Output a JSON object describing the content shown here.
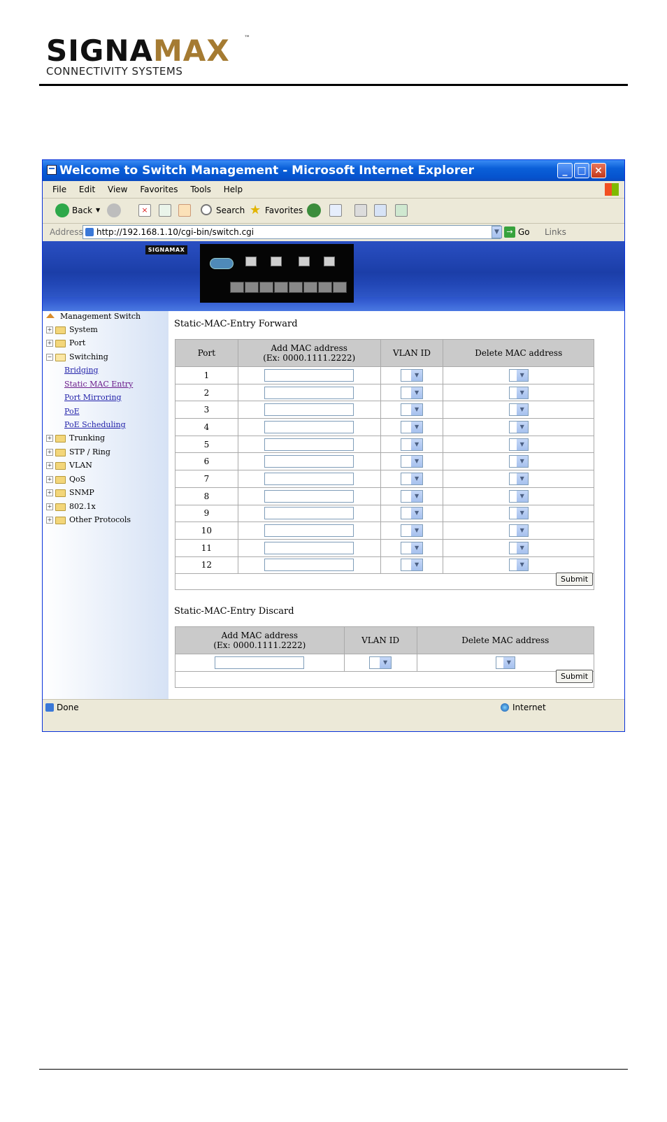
{
  "doc": {
    "logo": {
      "brand_part1": "SIGNA",
      "brand_part2": "MAX",
      "tagline": "CONNECTIVITY SYSTEMS",
      "tm": "™"
    }
  },
  "window": {
    "title": "Welcome to Switch Management - Microsoft Internet Explorer",
    "menu": [
      "File",
      "Edit",
      "View",
      "Favorites",
      "Tools",
      "Help"
    ],
    "toolbar": {
      "back_label": "Back",
      "search_label": "Search",
      "favorites_label": "Favorites"
    },
    "address": {
      "label": "Address",
      "url": "http://192.168.1.10/cgi-bin/switch.cgi",
      "go_label": "Go",
      "links_label": "Links"
    },
    "status": {
      "text": "Done",
      "zone": "Internet"
    }
  },
  "banner": {
    "logo_text": "SIGNAMAX"
  },
  "sidebar": {
    "root": "Management Switch",
    "items": [
      {
        "label": "System",
        "type": "folder"
      },
      {
        "label": "Port",
        "type": "folder"
      },
      {
        "label": "Switching",
        "type": "folder-open"
      },
      {
        "label": "Bridging",
        "type": "link"
      },
      {
        "label": "Static MAC Entry",
        "type": "link-visited"
      },
      {
        "label": "Port Mirroring",
        "type": "link"
      },
      {
        "label": "PoE",
        "type": "link"
      },
      {
        "label": "PoE Scheduling",
        "type": "link"
      },
      {
        "label": "Trunking",
        "type": "folder"
      },
      {
        "label": "STP / Ring",
        "type": "folder"
      },
      {
        "label": "VLAN",
        "type": "folder"
      },
      {
        "label": "QoS",
        "type": "folder"
      },
      {
        "label": "SNMP",
        "type": "folder"
      },
      {
        "label": "802.1x",
        "type": "folder"
      },
      {
        "label": "Other Protocols",
        "type": "folder"
      }
    ]
  },
  "forward": {
    "title": "Static-MAC-Entry Forward",
    "headers": {
      "port": "Port",
      "add_mac_line1": "Add MAC address",
      "add_mac_line2": "(Ex: 0000.1111.2222)",
      "vlan": "VLAN ID",
      "delete_mac": "Delete MAC address"
    },
    "ports": [
      "1",
      "2",
      "3",
      "4",
      "5",
      "6",
      "7",
      "8",
      "9",
      "10",
      "11",
      "12"
    ],
    "submit_label": "Submit"
  },
  "discard": {
    "title": "Static-MAC-Entry Discard",
    "headers": {
      "add_mac_line1": "Add MAC address",
      "add_mac_line2": "(Ex: 0000.1111.2222)",
      "vlan": "VLAN ID",
      "delete_mac": "Delete MAC address"
    },
    "submit_label": "Submit"
  }
}
